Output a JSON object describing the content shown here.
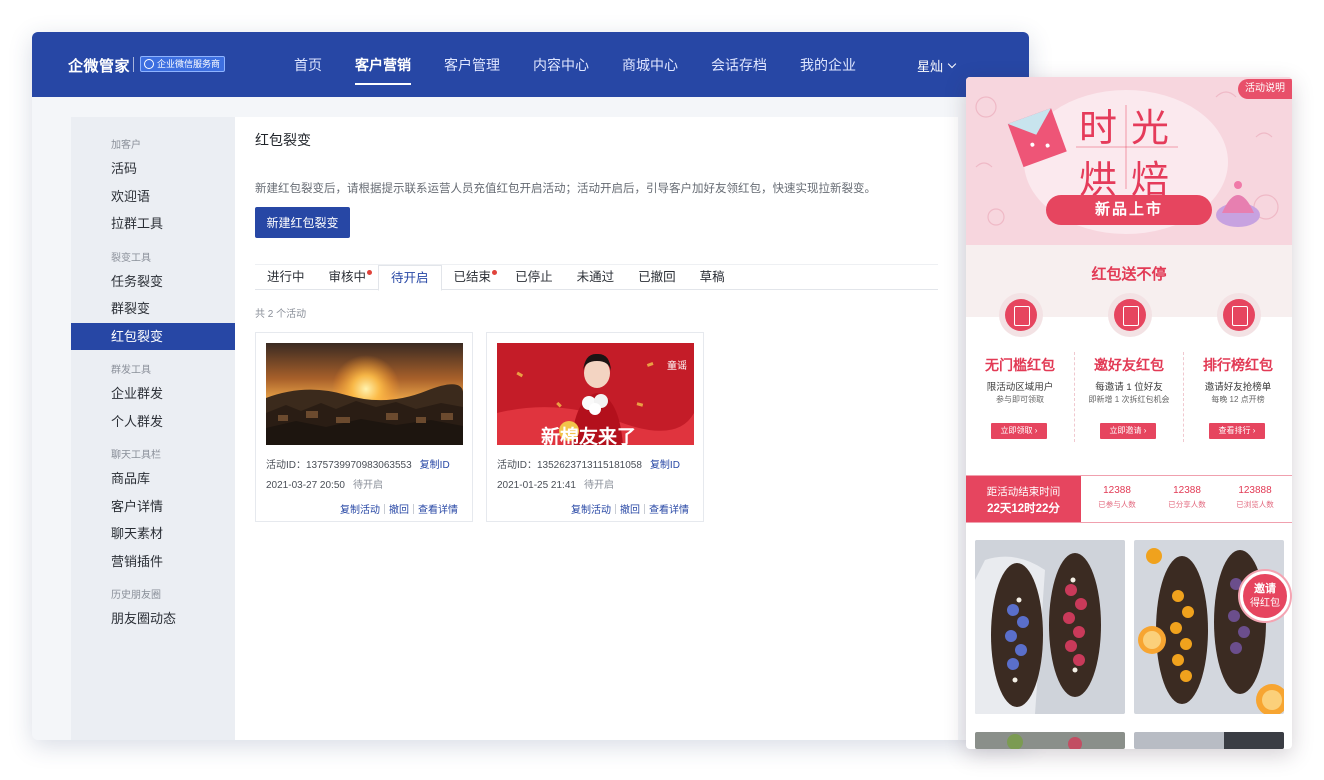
{
  "app": {
    "brand": "企微管家",
    "badge": "企业微信服务商",
    "nav": [
      "首页",
      "客户营销",
      "客户管理",
      "内容中心",
      "商城中心",
      "会话存档",
      "我的企业"
    ],
    "active_nav": "客户营销",
    "user": "星灿"
  },
  "sidebar": {
    "groups": [
      {
        "title": "加客户",
        "items": [
          "活码",
          "欢迎语",
          "拉群工具"
        ]
      },
      {
        "title": "裂变工具",
        "items": [
          "任务裂变",
          "群裂变",
          "红包裂变"
        ]
      },
      {
        "title": "群发工具",
        "items": [
          "企业群发",
          "个人群发"
        ]
      },
      {
        "title": "聊天工具栏",
        "items": [
          "商品库",
          "客户详情",
          "聊天素材",
          "营销插件"
        ]
      },
      {
        "title": "历史朋友圈",
        "items": [
          "朋友圈动态"
        ]
      }
    ],
    "active": "红包裂变"
  },
  "main": {
    "title": "红包裂变",
    "description": "新建红包裂变后，请根据提示联系运营人员充值红包开启活动；活动开启后，引导客户加好友领红包，快速实现拉新裂变。",
    "new_button": "新建红包裂变",
    "tabs": [
      {
        "label": "进行中",
        "dot": false
      },
      {
        "label": "审核中",
        "dot": true
      },
      {
        "label": "待开启",
        "dot": false
      },
      {
        "label": "已结束",
        "dot": true
      },
      {
        "label": "已停止",
        "dot": false
      },
      {
        "label": "未通过",
        "dot": false
      },
      {
        "label": "已撤回",
        "dot": false
      },
      {
        "label": "草稿",
        "dot": false
      }
    ],
    "active_tab": "待开启",
    "count_text": "共 2 个活动",
    "cards": [
      {
        "id_label": "活动ID：1375739970983063553",
        "copy_id": "复制ID",
        "date": "2021-03-27 20:50",
        "status": "待开启",
        "actions": [
          "复制活动",
          "撤回",
          "查看详情"
        ]
      },
      {
        "id_label": "活动ID：1352623713115181058",
        "copy_id": "复制ID",
        "date": "2021-01-25 21:41",
        "status": "待开启",
        "actions": [
          "复制活动",
          "撤回",
          "查看详情"
        ],
        "poster_text": "新棉友来了",
        "poster_name": "童谣"
      }
    ]
  },
  "phone": {
    "explain": "活动说明",
    "title_line1": "时光",
    "title_line2": "烘焙",
    "ribbon": "新品上市",
    "section_title": "红包送不停",
    "columns": [
      {
        "title": "无门槛红包",
        "line1": "限活动区域用户",
        "line2": "参与即可领取",
        "button": "立即领取 ›"
      },
      {
        "title": "邀好友红包",
        "line1": "每邀请 1 位好友",
        "line2": "即新增 1 次拆红包机会",
        "button": "立即邀请 ›"
      },
      {
        "title": "排行榜红包",
        "line1": "邀请好友抢榜单",
        "line2": "每晚 12 点开榜",
        "button": "查看排行 ›"
      }
    ],
    "countdown_label": "距活动结束时间",
    "countdown_value": "22天12时22分",
    "stats": [
      {
        "value": "12388",
        "label": "已参与人数"
      },
      {
        "value": "12388",
        "label": "已分享人数"
      },
      {
        "value": "123888",
        "label": "已浏览人数"
      }
    ],
    "invite_line1": "邀请",
    "invite_line2": "得红包"
  },
  "colors": {
    "primary": "#2747a5",
    "accent_red": "#e6455f",
    "text": "#2b2f36"
  }
}
